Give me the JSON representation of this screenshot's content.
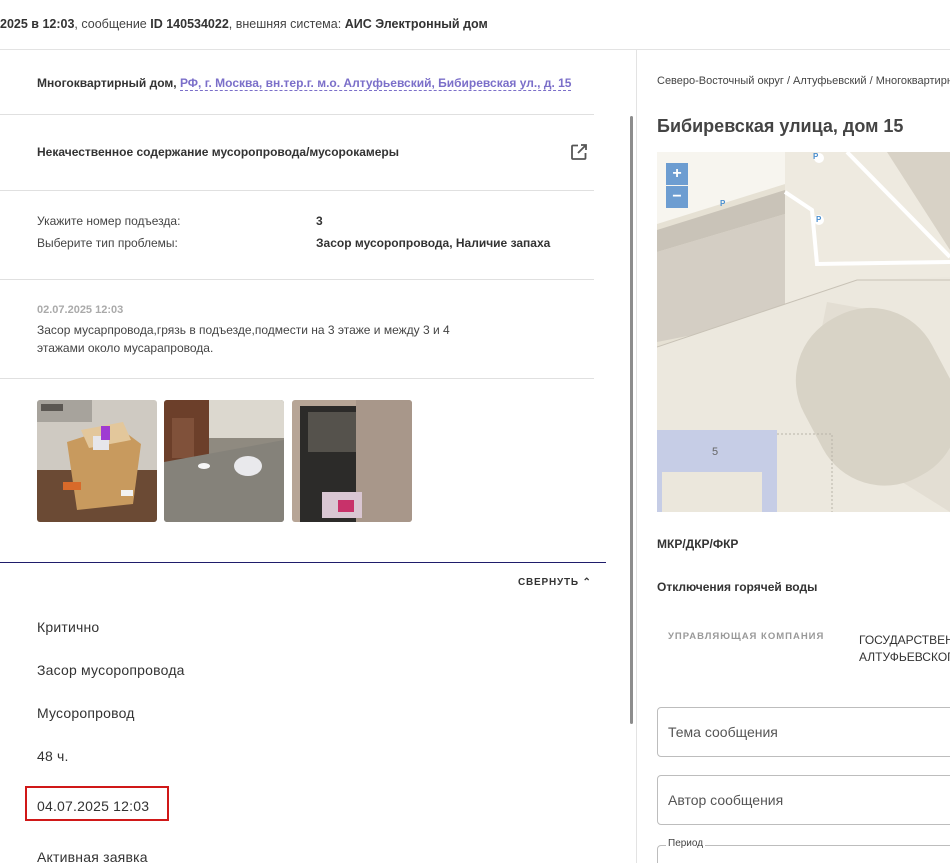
{
  "header": {
    "date_prefix": "2025 в 12:03",
    "message_word": ", сообщение ",
    "message_id": "ID 140534022",
    "system_word": ", внешняя система: ",
    "system_name": "АИС Электронный дом"
  },
  "request": {
    "building_type": "Многоквартирный дом, ",
    "address_link": "РФ, г. Москва, вн.тер.г. м.о. Алтуфьевский, Бибиревская ул., д. 15",
    "issue_title": "Некачественное содержание мусоропровода/мусорокамеры",
    "questions": [
      {
        "label": "Укажите номер подъезда:",
        "value": "3"
      },
      {
        "label": "Выберите тип проблемы:",
        "value": "Засор мусоропровода, Наличие запаха"
      }
    ],
    "comment": {
      "date": "02.07.2025 12:03",
      "text": "Засор мусарпровода,грязь в подъезде,подмести на 3 этаже и между 3 и 4 этажами около мусарапровода."
    }
  },
  "details": {
    "collapse_label": "СВЕРНУТЬ",
    "priority": "Критично",
    "problem": "Засор мусоропровода",
    "category": "Мусоропровод",
    "deadline_hours": "48 ч.",
    "deadline_date": "04.07.2025 12:03",
    "status": "Активная заявка"
  },
  "right_panel": {
    "breadcrumb": "Северо-Восточный округ / Алтуфьевский / Многоквартирный дом",
    "title": "Бибиревская улица, дом 15",
    "map": {
      "building_number": "5",
      "zoom_in": "+",
      "zoom_out": "−",
      "parking_label": "P"
    },
    "mkr_label": "МКР/ДКР/ФКР",
    "hot_water_label": "Отключения горячей воды",
    "uk_label": "УПРАВЛЯЮЩАЯ КОМПАНИЯ",
    "gos_line1": "ГОСУДАРСТВЕННОЕ",
    "gos_line2": "АЛТУФЬЕВСКОГО",
    "topic_placeholder": "Тема сообщения",
    "author_placeholder": "Автор сообщения",
    "period_label": "Период"
  },
  "colors": {
    "link": "#7b6fc9",
    "highlight": "#d01818",
    "map_zoom": "#6d9dd1",
    "accent_line": "#1f1d6b"
  }
}
